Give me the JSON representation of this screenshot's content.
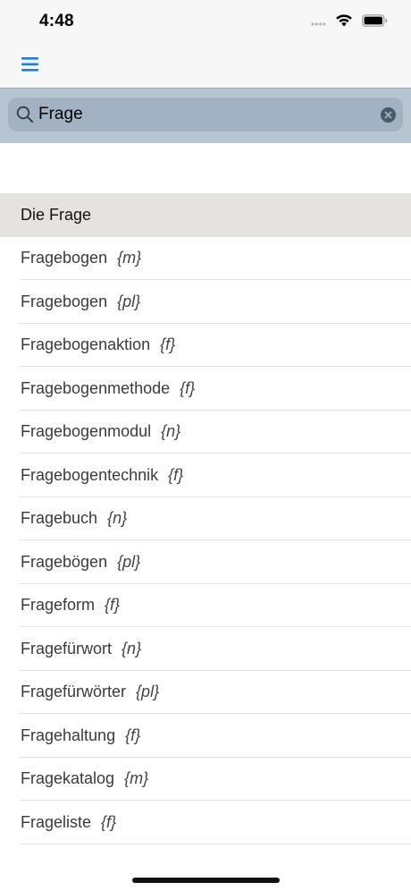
{
  "status_bar": {
    "time": "4:48"
  },
  "nav": {
    "menu_icon": "hamburger-menu-icon",
    "accent": "#1a7ee2"
  },
  "search": {
    "value": "Frage",
    "icon": "search-icon",
    "clear_icon": "clear-icon"
  },
  "results": {
    "header": "Die Frage",
    "items": [
      {
        "word": "Fragebogen",
        "gender": "{m}"
      },
      {
        "word": "Fragebogen",
        "gender": "{pl}"
      },
      {
        "word": "Fragebogenaktion",
        "gender": "{f}"
      },
      {
        "word": "Fragebogenmethode",
        "gender": "{f}"
      },
      {
        "word": "Fragebogenmodul",
        "gender": "{n}"
      },
      {
        "word": "Fragebogentechnik",
        "gender": "{f}"
      },
      {
        "word": "Fragebuch",
        "gender": "{n}"
      },
      {
        "word": "Fragebögen",
        "gender": "{pl}"
      },
      {
        "word": "Frageform",
        "gender": "{f}"
      },
      {
        "word": "Fragefürwort",
        "gender": "{n}"
      },
      {
        "word": "Fragefürwörter",
        "gender": "{pl}"
      },
      {
        "word": "Fragehaltung",
        "gender": "{f}"
      },
      {
        "word": "Fragekatalog",
        "gender": "{m}"
      },
      {
        "word": "Frageliste",
        "gender": "{f}"
      }
    ]
  }
}
